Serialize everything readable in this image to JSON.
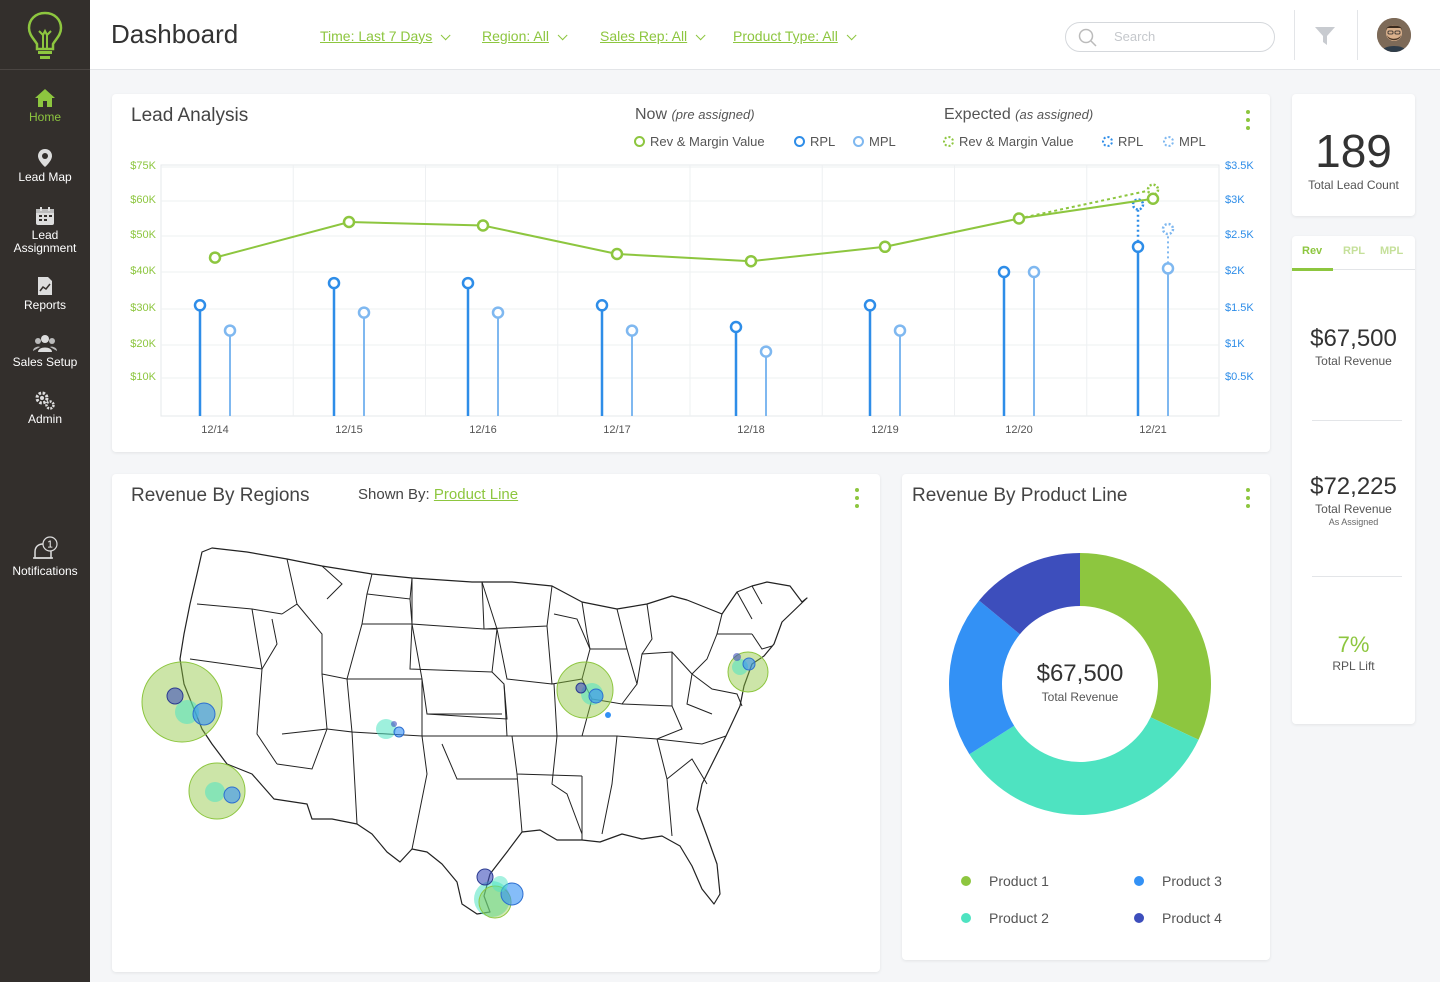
{
  "sidebar": {
    "items": [
      {
        "label": "Home"
      },
      {
        "label": "Lead Map"
      },
      {
        "label": "Lead\nAssignment"
      },
      {
        "label": "Reports"
      },
      {
        "label": "Sales Setup"
      },
      {
        "label": "Admin"
      },
      {
        "label": "Notifications"
      }
    ],
    "notification_count": "1"
  },
  "header": {
    "title": "Dashboard",
    "filters": [
      "Time: Last 7 Days",
      "Region: All",
      "Sales Rep: All",
      "Product Type: All"
    ],
    "search_placeholder": "Search"
  },
  "lead_analysis": {
    "title": "Lead Analysis",
    "now_label": "Now",
    "now_sub": "(pre assigned)",
    "expected_label": "Expected",
    "expected_sub": "(as assigned)",
    "legend_now": [
      "Rev & Margin Value",
      "RPL",
      "MPL"
    ],
    "legend_expected": [
      "Rev & Margin Value",
      "RPL",
      "MPL"
    ]
  },
  "chart_data": {
    "type": "line",
    "x": [
      "12/14",
      "12/15",
      "12/16",
      "12/17",
      "12/18",
      "12/19",
      "12/20",
      "12/21"
    ],
    "yticks_left": [
      "$75K",
      "$60K",
      "$50K",
      "$40K",
      "$30K",
      "$20K",
      "$10K"
    ],
    "yticks_right": [
      "$3.5K",
      "$3K",
      "$2.5K",
      "$2K",
      "$1.5K",
      "$1K",
      "$0.5K"
    ],
    "series": [
      {
        "name": "Rev & Margin Value",
        "axis": "left",
        "style": "line",
        "values": [
          44000,
          54000,
          53000,
          45000,
          43000,
          47000,
          55000,
          61000
        ]
      },
      {
        "name": "RPL",
        "axis": "right",
        "style": "stem",
        "values": [
          1.55,
          1.85,
          1.85,
          1.55,
          1.25,
          1.55,
          2.0,
          2.35
        ]
      },
      {
        "name": "MPL",
        "axis": "right",
        "style": "stem",
        "values": [
          1.2,
          1.45,
          1.45,
          1.2,
          0.9,
          1.2,
          2.0,
          2.05
        ]
      }
    ],
    "expected": {
      "Rev & Margin Value": {
        "from": "12/20",
        "to": "12/21",
        "value": 65000
      },
      "RPL": {
        "x": "12/21",
        "value": 2.95
      },
      "MPL": {
        "x": "12/21",
        "value": 2.6
      }
    },
    "colors": {
      "rev": "#8dc63f",
      "rpl": "#2e8de8",
      "mpl": "#7fb8f0"
    },
    "grid": true
  },
  "regions": {
    "title": "Revenue By Regions",
    "shown_by_label": "Shown By:",
    "shown_by_value": "Product Line"
  },
  "product_line": {
    "title": "Revenue By Product Line",
    "center_value": "$67,500",
    "center_label": "Total Revenue",
    "donut": [
      {
        "name": "Product 1",
        "value": 32,
        "color": "#8dc63f"
      },
      {
        "name": "Product 2",
        "value": 34,
        "color": "#4ee3c1"
      },
      {
        "name": "Product 3",
        "value": 20,
        "color": "#3391f5"
      },
      {
        "name": "Product 4",
        "value": 14,
        "color": "#3d4ebc"
      }
    ]
  },
  "stats": {
    "lead_count": "189",
    "lead_count_label": "Total Lead Count",
    "tabs": [
      "Rev",
      "RPL",
      "MPL"
    ],
    "total_revenue": "$67,500",
    "total_revenue_label": "Total Revenue",
    "assigned_revenue": "$72,225",
    "assigned_revenue_label": "Total Revenue",
    "assigned_revenue_sub": "As Assigned",
    "rpl_lift": "7%",
    "rpl_lift_label": "RPL Lift"
  }
}
